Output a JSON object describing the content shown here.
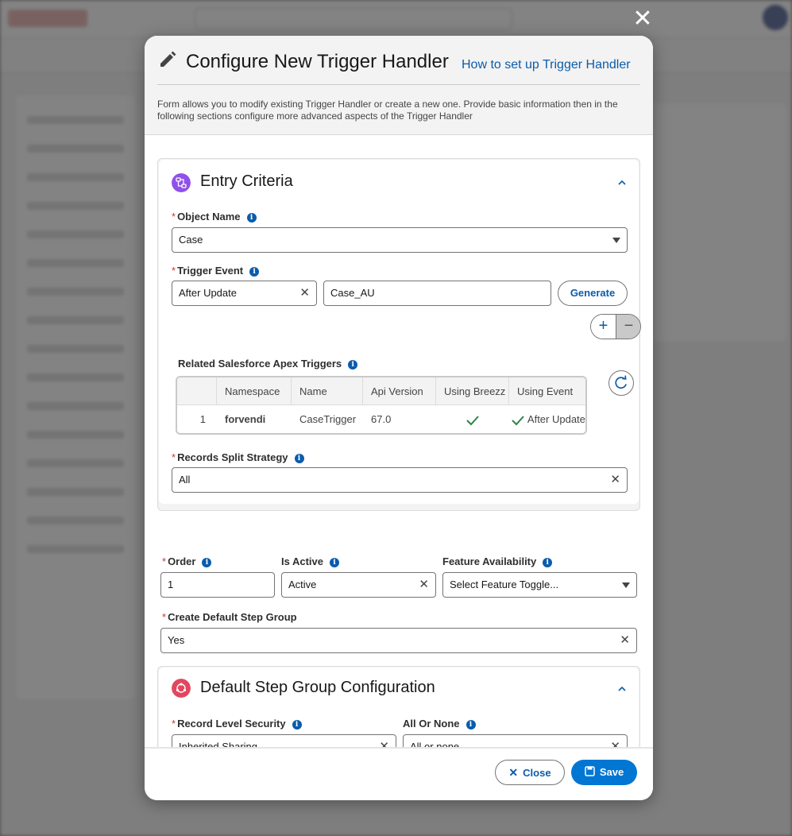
{
  "modal": {
    "title": "Configure New Trigger Handler",
    "help_link": "How to set up Trigger Handler",
    "description": "Form allows you to modify existing Trigger Handler or create a new one. Provide basic information then in the following sections configure more advanced aspects of the Trigger Handler",
    "close_symbol": "✕"
  },
  "entry_criteria": {
    "title": "Entry Criteria",
    "object_name_label": "Object Name",
    "object_name_value": "Case",
    "trigger_event_label": "Trigger Event",
    "trigger_event_value": "After Update",
    "trigger_name_value": "Case_AU",
    "generate_label": "Generate",
    "plus_label": "+",
    "minus_label": "−",
    "related_triggers_label": "Related Salesforce Apex Triggers",
    "table": {
      "columns": [
        "Namespace",
        "Name",
        "Api Version",
        "Using Breezz",
        "Using Event"
      ],
      "rows": [
        {
          "num": "1",
          "namespace": "forvendi",
          "name": "CaseTrigger",
          "api_version": "67.0",
          "using_breezz": "✓",
          "using_event": "After Update"
        }
      ]
    },
    "split_strategy_label": "Records Split Strategy",
    "split_strategy_value": "All"
  },
  "general": {
    "order_label": "Order",
    "order_value": "1",
    "is_active_label": "Is Active",
    "is_active_value": "Active",
    "feature_label": "Feature Availability",
    "feature_placeholder": "Select Feature Toggle...",
    "default_step_label": "Create Default Step Group",
    "default_step_value": "Yes"
  },
  "step_group": {
    "title": "Default Step Group Configuration",
    "security_label": "Record Level Security",
    "security_value": "Inherited Sharing",
    "all_or_none_label": "All Or None",
    "all_or_none_value": "All or none"
  },
  "footer": {
    "close_label": "Close",
    "save_label": "Save"
  },
  "colors": {
    "brand": "#0176d3",
    "link": "#0b5cab",
    "required": "#c23934",
    "entry_icon": "#9050e9",
    "step_icon": "#e3475f",
    "check": "#2e844a"
  },
  "icons": {
    "header": "pencil-icon",
    "entry": "flow-icon",
    "step": "step-group-icon",
    "refresh": "refresh-icon",
    "chevron": "chevron-up-icon",
    "save": "save-icon"
  }
}
